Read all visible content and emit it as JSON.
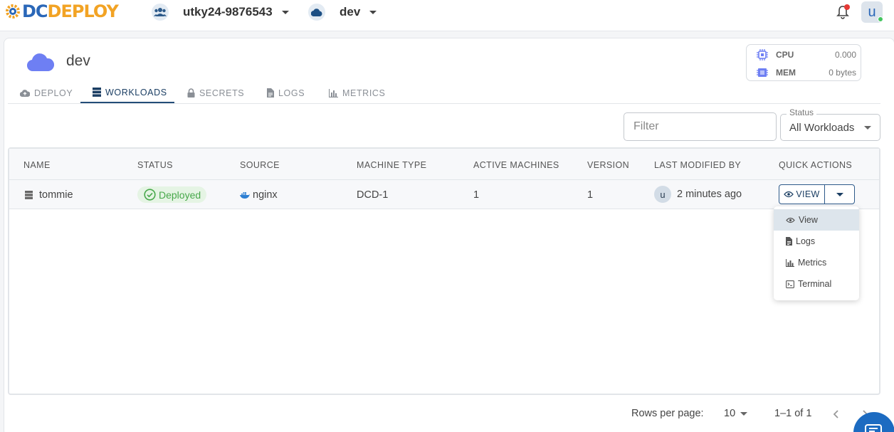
{
  "brand": {
    "logo_dc": "DC",
    "logo_deploy": "DEPLOY"
  },
  "header": {
    "organization": "utky24-9876543",
    "environment": "dev",
    "user_initial": "u"
  },
  "environment": {
    "name": "dev",
    "resources": {
      "cpu_label": "CPU",
      "cpu_value": "0.000",
      "mem_label": "MEM",
      "mem_value": "0 bytes"
    }
  },
  "tabs": [
    {
      "label": "DEPLOY",
      "icon": "cloud-upload-icon"
    },
    {
      "label": "WORKLOADS",
      "icon": "server-icon",
      "active": true
    },
    {
      "label": "SECRETS",
      "icon": "lock-icon"
    },
    {
      "label": "LOGS",
      "icon": "document-icon"
    },
    {
      "label": "METRICS",
      "icon": "bar-chart-icon"
    }
  ],
  "filters": {
    "filter_placeholder": "Filter",
    "status_label": "Status",
    "status_value": "All Workloads"
  },
  "table": {
    "columns": [
      "NAME",
      "STATUS",
      "SOURCE",
      "MACHINE TYPE",
      "ACTIVE MACHINES",
      "VERSION",
      "LAST MODIFIED BY",
      "QUICK ACTIONS"
    ],
    "rows": [
      {
        "name": "tommie",
        "status": "Deployed",
        "source": "nginx",
        "machine_type": "DCD-1",
        "active_machines": "1",
        "version": "1",
        "modified_by_initial": "u",
        "modified_time": "2 minutes ago",
        "action_label": "VIEW"
      }
    ]
  },
  "quick_actions_menu": [
    {
      "label": "View",
      "icon": "eye-icon"
    },
    {
      "label": "Logs",
      "icon": "document-icon"
    },
    {
      "label": "Metrics",
      "icon": "bar-chart-icon"
    },
    {
      "label": "Terminal",
      "icon": "terminal-icon"
    }
  ],
  "pagination": {
    "rows_per_page_label": "Rows per page:",
    "rows_per_page_value": "10",
    "range": "1–1 of 1"
  },
  "colors": {
    "brand_blue": "#2a67b8",
    "brand_orange": "#f2a324",
    "accent_navy": "#1b3e63",
    "status_green": "#47a84a",
    "env_cloud": "#6e7ff3"
  }
}
